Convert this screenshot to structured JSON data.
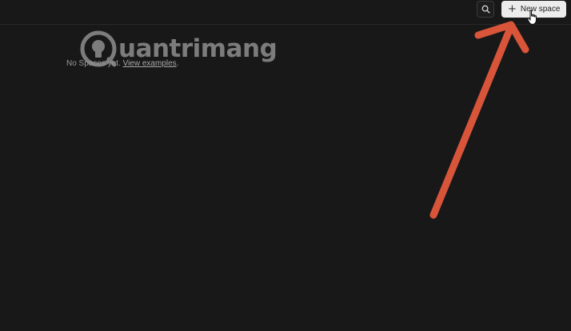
{
  "header": {
    "search_icon": "search-icon",
    "new_space": {
      "icon": "plus-icon",
      "label": "New space"
    }
  },
  "main": {
    "empty_text": "No Spaces yet.",
    "empty_link": "View examples",
    "empty_suffix": "."
  },
  "watermark": {
    "text": "uantrimang"
  },
  "colors": {
    "background": "#191819",
    "button_bg": "#ececec",
    "arrow": "#d9553a"
  }
}
